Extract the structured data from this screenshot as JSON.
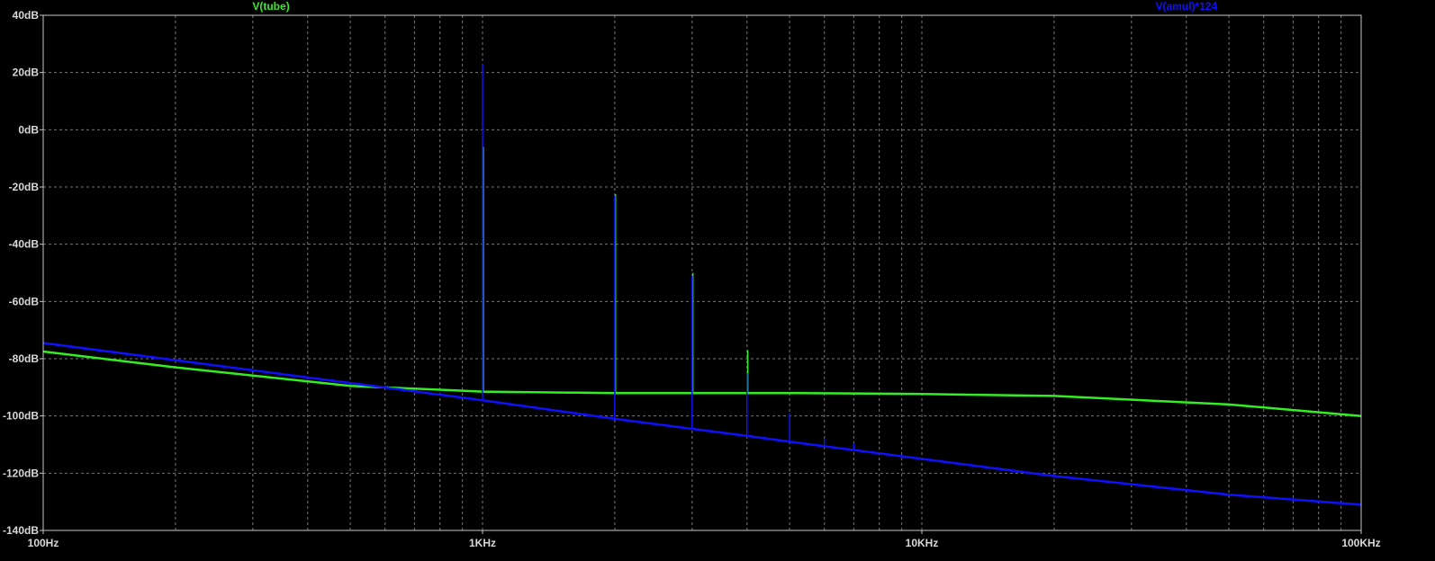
{
  "chart_data": {
    "type": "line",
    "title": "",
    "xlabel": "",
    "ylabel": "",
    "x_scale": "log",
    "xlim": [
      100,
      100000
    ],
    "ylim": [
      -140,
      40
    ],
    "grid": true,
    "legend_position": "top",
    "x_ticks": [
      {
        "value": 100,
        "label": "100Hz"
      },
      {
        "value": 1000,
        "label": "1KHz"
      },
      {
        "value": 10000,
        "label": "10KHz"
      },
      {
        "value": 100000,
        "label": "100KHz"
      }
    ],
    "y_ticks": [
      {
        "value": 40,
        "label": "40dB"
      },
      {
        "value": 20,
        "label": "20dB"
      },
      {
        "value": 0,
        "label": "0dB"
      },
      {
        "value": -20,
        "label": "-20dB"
      },
      {
        "value": -40,
        "label": "-40dB"
      },
      {
        "value": -60,
        "label": "-60dB"
      },
      {
        "value": -80,
        "label": "-80dB"
      },
      {
        "value": -100,
        "label": "-100dB"
      },
      {
        "value": -120,
        "label": "-120dB"
      },
      {
        "value": -140,
        "label": "-140dB"
      }
    ],
    "series": [
      {
        "name": "V(tube)",
        "color": "#33ee22",
        "baseline": [
          [
            100,
            -77.5
          ],
          [
            200,
            -83
          ],
          [
            500,
            -89.5
          ],
          [
            1000,
            -91.5
          ],
          [
            2000,
            -92
          ],
          [
            5000,
            -92
          ],
          [
            10000,
            -92.3
          ],
          [
            20000,
            -93
          ],
          [
            50000,
            -96
          ],
          [
            100000,
            -100
          ]
        ],
        "peaks": [
          [
            1000,
            -6
          ],
          [
            2000,
            -22.5
          ],
          [
            3000,
            -50
          ],
          [
            4000,
            -77
          ]
        ]
      },
      {
        "name": "V(amul)*124",
        "color": "#1010ff",
        "baseline": [
          [
            100,
            -74.5
          ],
          [
            1000,
            -94.5
          ],
          [
            2000,
            -101
          ],
          [
            3000,
            -104.5
          ],
          [
            4000,
            -107
          ],
          [
            5000,
            -109
          ],
          [
            10000,
            -115
          ],
          [
            20000,
            -121
          ],
          [
            50000,
            -127.5
          ],
          [
            100000,
            -131
          ]
        ],
        "peaks": [
          [
            1000,
            23
          ],
          [
            2000,
            -23
          ],
          [
            3000,
            -51
          ],
          [
            4000,
            -85
          ],
          [
            5000,
            -99
          ],
          [
            6000,
            -108
          ],
          [
            7000,
            -109.5
          ]
        ]
      }
    ]
  }
}
